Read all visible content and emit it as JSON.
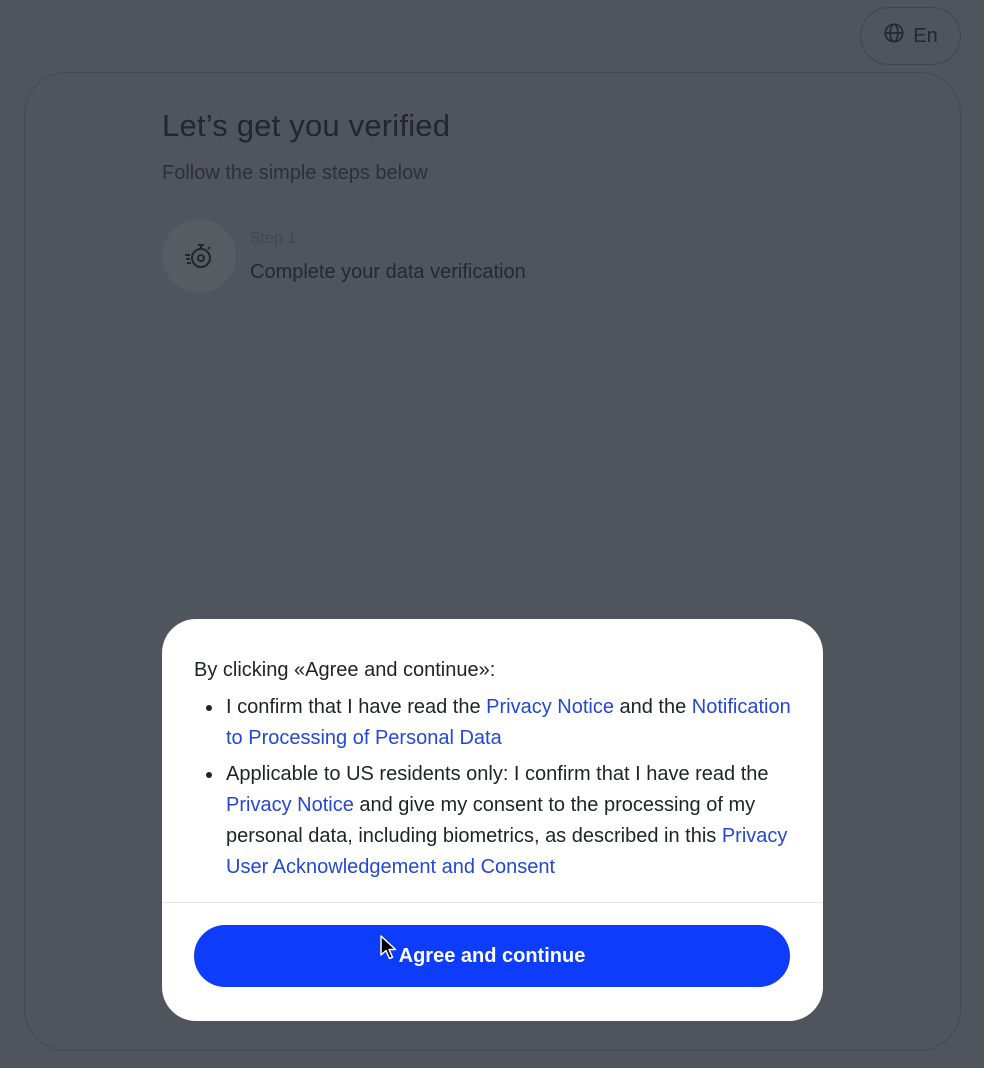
{
  "header": {
    "language_label": "En",
    "language_icon": "globe-icon"
  },
  "card": {
    "title": "Let’s get you verified",
    "subtitle": "Follow the simple steps below",
    "steps": [
      {
        "icon": "stopwatch-icon",
        "label": "Step 1",
        "text": "Complete your data verification"
      }
    ]
  },
  "modal": {
    "intro": "By clicking «Agree and continue»:",
    "items": [
      {
        "p1": "I confirm that I have read the ",
        "link1": "Privacy Notice",
        "p2": " and the ",
        "link2": "Notification to Processing of Personal Data"
      },
      {
        "p1": "Applicable to US residents only: I confirm that I have read the ",
        "link1": "Privacy Notice",
        "p2": " and give my consent to the processing of my personal data, including biometrics, as described in this ",
        "link2": "Privacy User Acknowledgement and Consent"
      }
    ],
    "button_label": "Agree and continue"
  },
  "colors": {
    "overlay_background": "#50545c",
    "primary_button": "#0d3dfa",
    "link": "#2447d6"
  }
}
